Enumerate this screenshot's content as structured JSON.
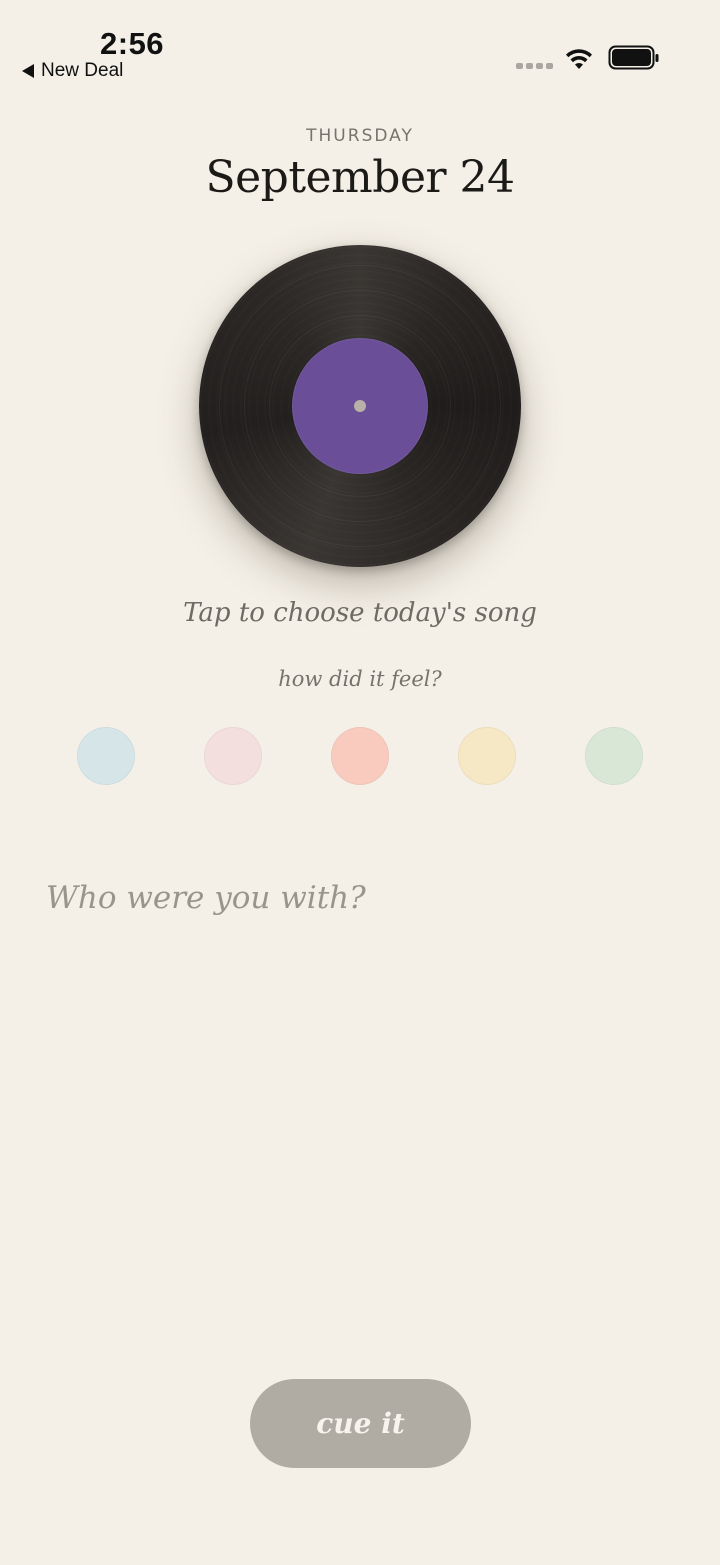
{
  "status_bar": {
    "time": "2:56",
    "back_label": "New Deal",
    "icons": [
      "signal-icon",
      "wifi-icon",
      "battery-icon"
    ]
  },
  "header": {
    "weekday": "THURSDAY",
    "date": "September 24"
  },
  "record": {
    "label_color": "#6a4f98",
    "prompt": "Tap to choose today's song"
  },
  "mood": {
    "prompt": "how did it feel?",
    "options": [
      {
        "name": "mood-blue",
        "color": "#d6e5e8"
      },
      {
        "name": "mood-pink",
        "color": "#f4dfdf"
      },
      {
        "name": "mood-salmon",
        "color": "#f8cbbe"
      },
      {
        "name": "mood-yellow",
        "color": "#f6e8c5"
      },
      {
        "name": "mood-green",
        "color": "#d9e8d6"
      }
    ]
  },
  "companion": {
    "placeholder": "Who were you with?",
    "value": ""
  },
  "actions": {
    "cue_label": "cue it"
  }
}
